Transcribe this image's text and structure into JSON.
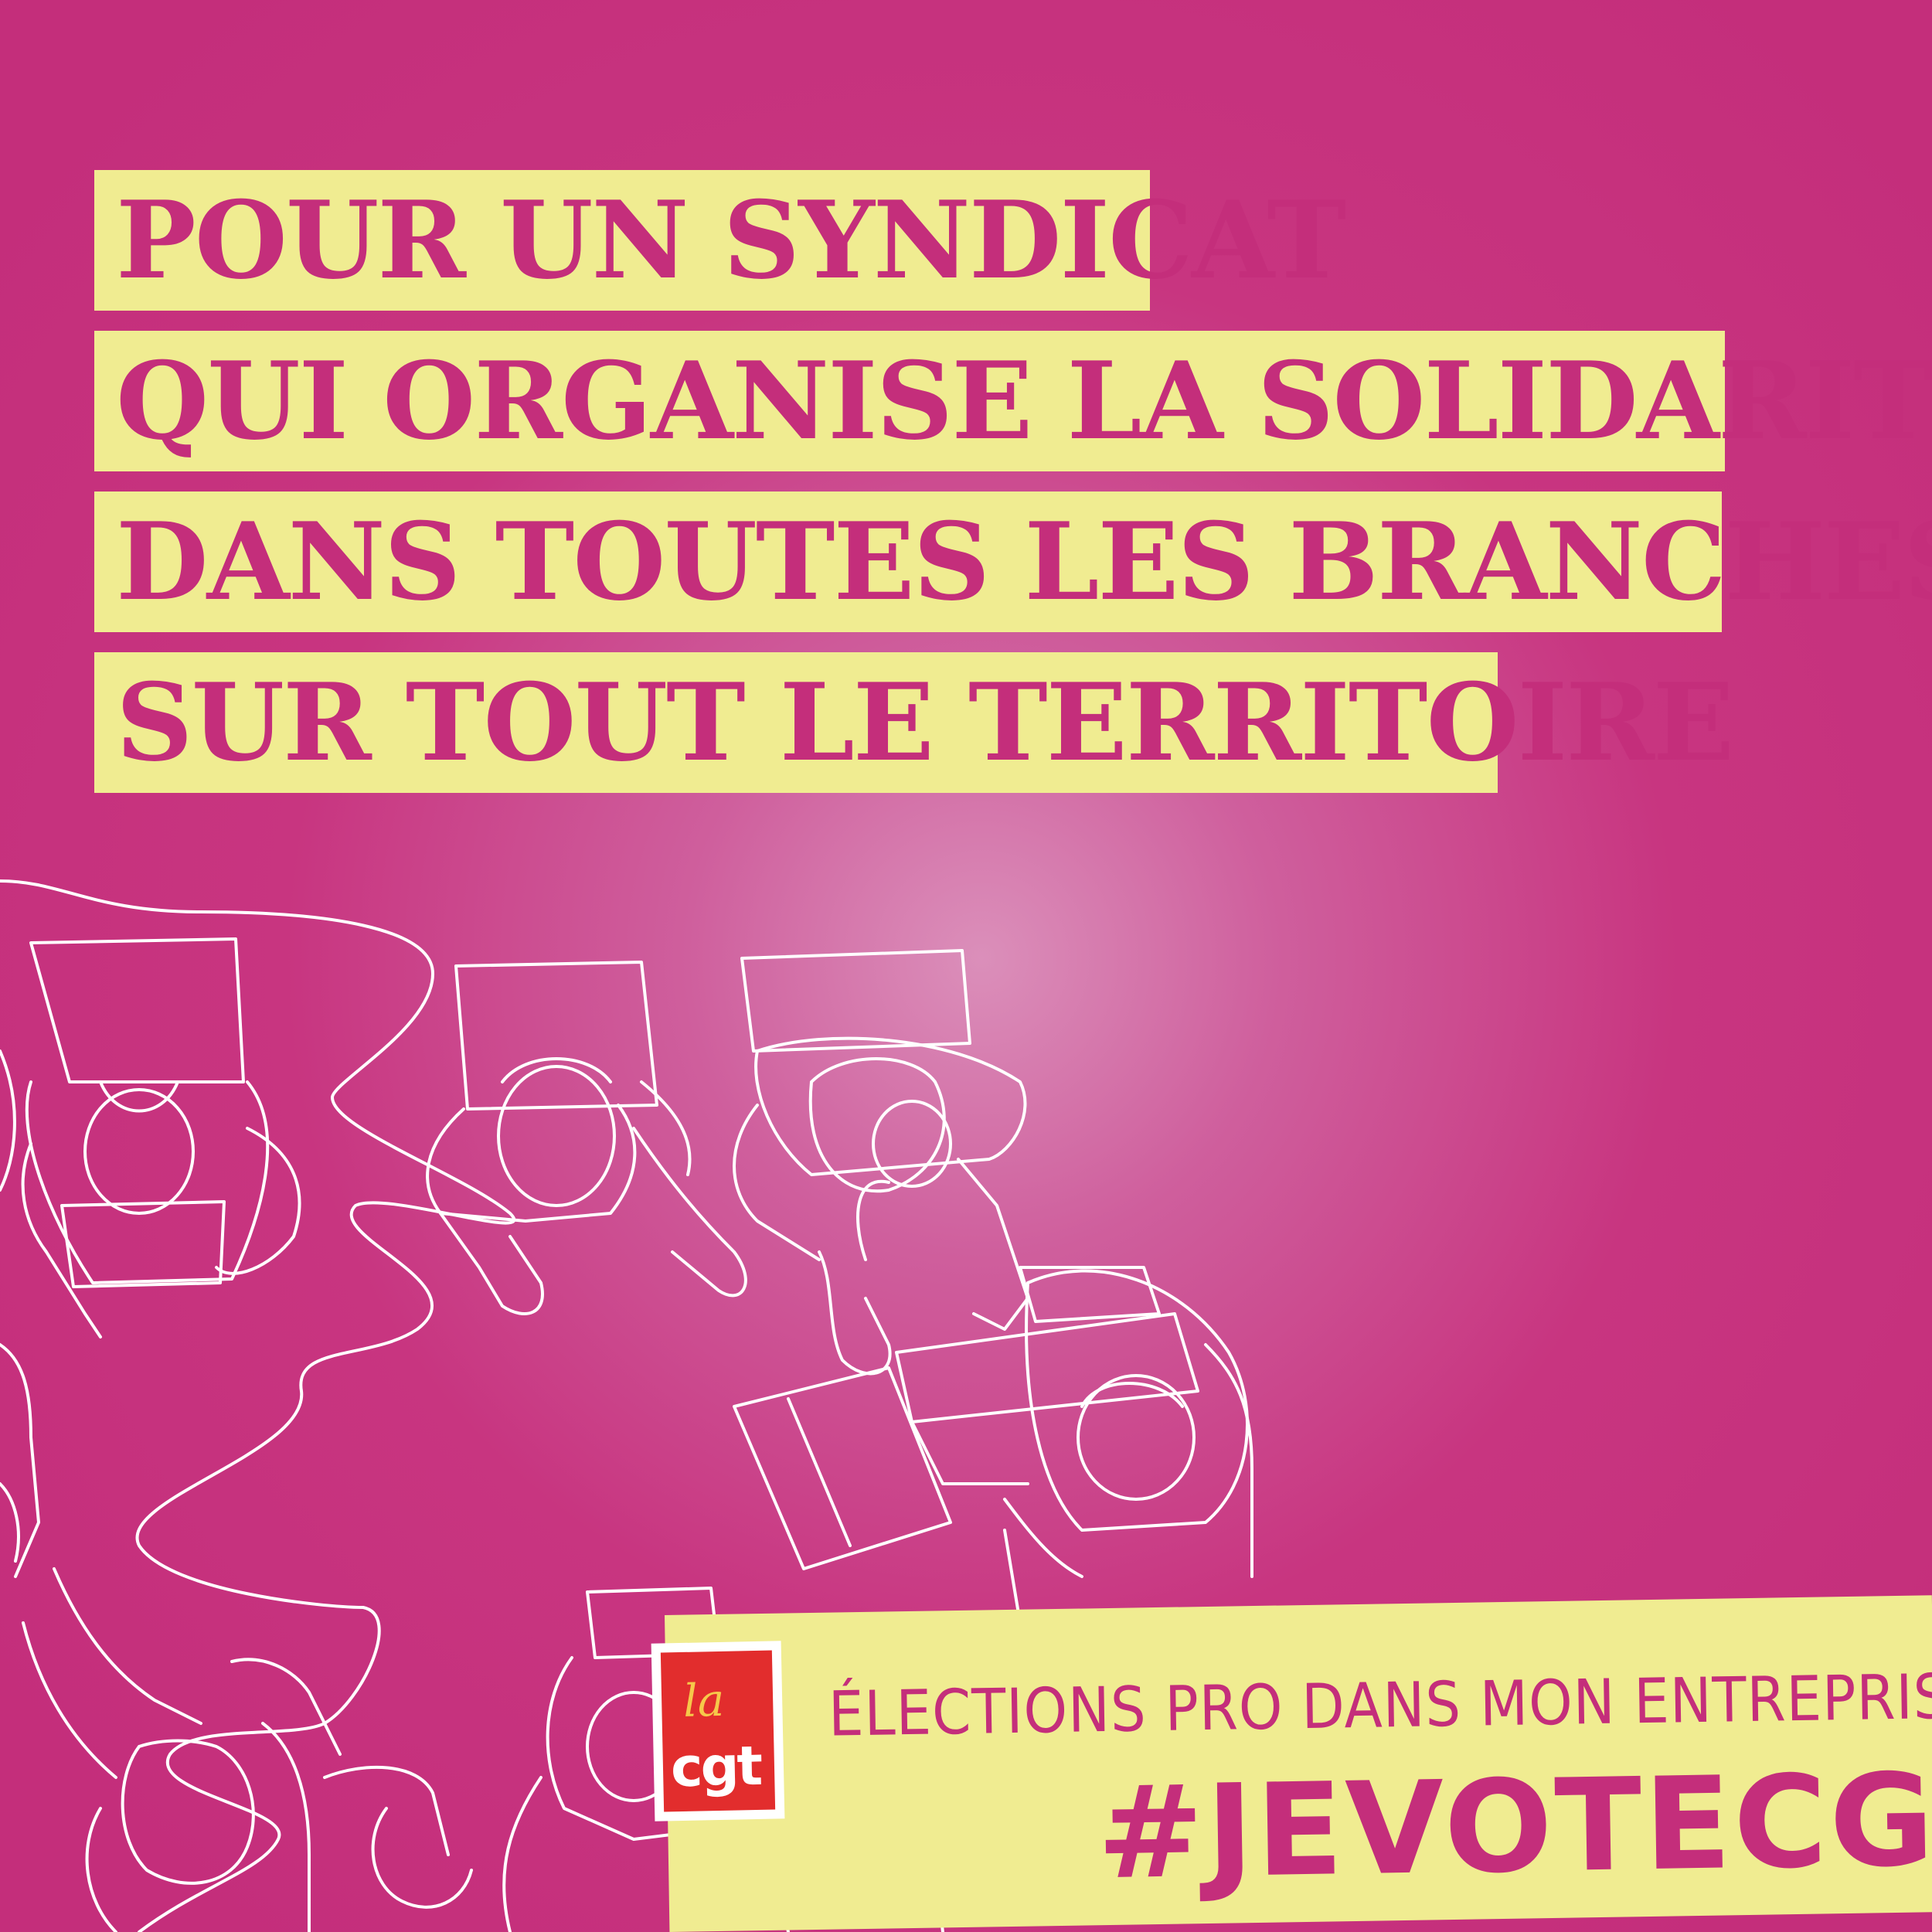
{
  "headline": {
    "line1": "POUR UN SYNDICAT",
    "line2": "QUI ORGANISE LA SOLIDARITÉ",
    "line3": "DANS TOUTES LES BRANCHES,",
    "line4": "SUR TOUT LE TERRITOIRE"
  },
  "footer": {
    "label": "ÉLECTIONS PRO DANS MON ENTREPRISE :",
    "hashtag": "#JEVOTECGT"
  },
  "logo": {
    "la": "la",
    "cgt": "cgt"
  },
  "colors": {
    "background": "#c42e7b",
    "highlight": "#f0ec91",
    "text": "#c42e7b",
    "line_art": "#ffffff",
    "logo_red": "#e22d2d"
  }
}
